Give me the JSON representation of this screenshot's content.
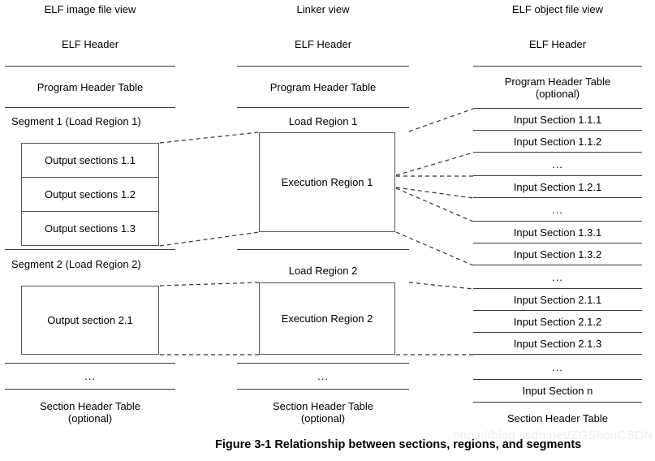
{
  "figure": {
    "caption": "Figure 3-1  Relationship between sections, regions, and segments",
    "watermark": "https://blog.csdn.net/ZGShouCSDN"
  },
  "columns": {
    "image_view": {
      "title": "ELF image file view",
      "rows": {
        "elf_header": "ELF Header",
        "program_header_table": "Program Header Table",
        "segment1_label": "Segment 1 (Load Region 1)",
        "output_section_1_1": "Output sections 1.1",
        "output_section_1_2": "Output sections 1.2",
        "output_section_1_3": "Output sections 1.3",
        "segment2_label": "Segment 2 (Load Region 2)",
        "output_section_2_1": "Output section 2.1",
        "ellipsis": "...",
        "section_header_table": "Section Header Table\n(optional)",
        "section_header_table_line1": "Section Header Table",
        "section_header_table_line2": "(optional)"
      }
    },
    "linker_view": {
      "title": "Linker view",
      "rows": {
        "elf_header": "ELF Header",
        "program_header_table": "Program Header Table",
        "load_region_1": "Load Region 1",
        "execution_region_1": "Execution Region 1",
        "load_region_2": "Load Region 2",
        "execution_region_2": "Execution Region 2",
        "ellipsis": "...",
        "section_header_table_line1": "Section Header Table",
        "section_header_table_line2": "(optional)"
      }
    },
    "object_view": {
      "title": "ELF object file view",
      "rows": [
        {
          "key": "elf-header",
          "label": "ELF Header"
        },
        {
          "key": "program-header-table",
          "label": "Program Header Table\n(optional)"
        },
        {
          "key": "input-section-1-1-1",
          "label": "Input Section 1.1.1"
        },
        {
          "key": "input-section-1-1-2",
          "label": "Input Section 1.1.2"
        },
        {
          "key": "ellipsis-1",
          "label": "..."
        },
        {
          "key": "input-section-1-2-1",
          "label": "Input Section 1.2.1"
        },
        {
          "key": "ellipsis-2",
          "label": "..."
        },
        {
          "key": "input-section-1-3-1",
          "label": "Input Section 1.3.1"
        },
        {
          "key": "input-section-1-3-2",
          "label": "Input Section 1.3.2"
        },
        {
          "key": "ellipsis-3",
          "label": "..."
        },
        {
          "key": "input-section-2-1-1",
          "label": "Input Section 2.1.1"
        },
        {
          "key": "input-section-2-1-2",
          "label": "Input Section 2.1.2"
        },
        {
          "key": "input-section-2-1-3",
          "label": "Input Section 2.1.3"
        },
        {
          "key": "ellipsis-4",
          "label": "..."
        },
        {
          "key": "input-section-n",
          "label": "Input Section n"
        },
        {
          "key": "section-header-table",
          "label": "Section Header Table"
        }
      ],
      "program_header_table_line1": "Program Header Table",
      "program_header_table_line2": "(optional)"
    }
  },
  "style": {
    "stroke": "#3a3a3a",
    "dashed_stroke": "#333333",
    "background": "#ffffff",
    "text": "#000000"
  }
}
